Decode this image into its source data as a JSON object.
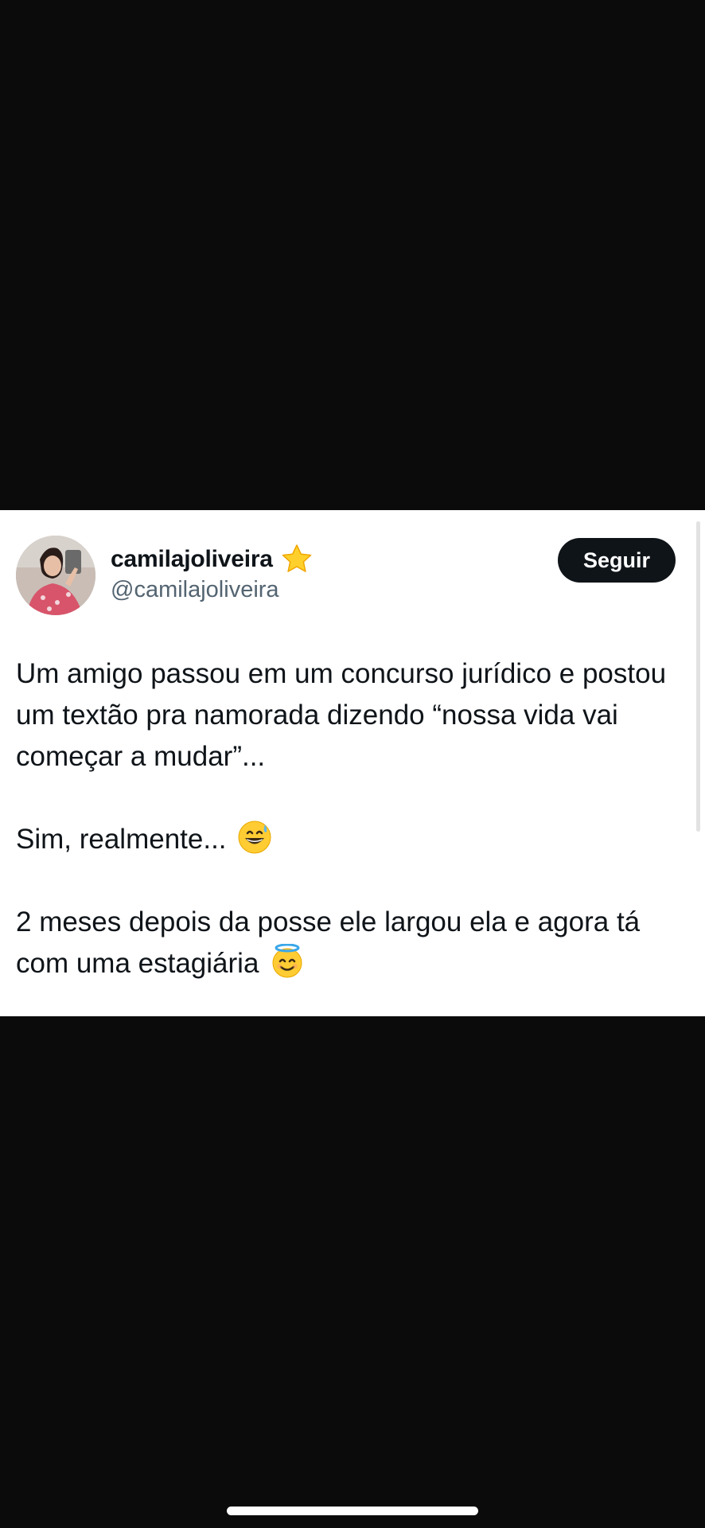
{
  "tweet": {
    "display_name": "camilajoliveira",
    "handle": "@camilajoliveira",
    "follow_label": "Seguir",
    "paragraphs": [
      "Um amigo passou em um concurso jurídico e postou um textão pra namorada dizendo “nossa vida vai começar a mudar”...",
      "Sim, realmente...",
      "2 meses depois da posse ele largou ela e agora tá com uma estagiária"
    ],
    "paragraph_emojis": [
      "",
      "grinning-sweat-emoji",
      "smiling-halo-emoji"
    ],
    "badge_icon": "star-icon"
  },
  "colors": {
    "background": "#0b0b0c",
    "card": "#ffffff",
    "text_primary": "#0f1419",
    "text_secondary": "#536471",
    "button_bg": "#0f1419",
    "button_text": "#ffffff"
  }
}
